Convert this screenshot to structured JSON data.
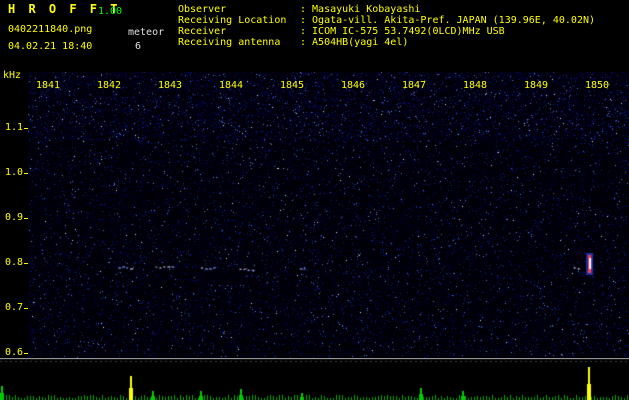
{
  "header": {
    "app_name": "H R O F F T",
    "version": "1.00",
    "filename": "0402211840.png",
    "mode": "meteor",
    "datetime": "04.02.21 18:40",
    "count": "6",
    "info": [
      {
        "label": "Observer",
        "value": ": Masayuki Kobayashi"
      },
      {
        "label": "Receiving Location",
        "value": ": Ogata-vill. Akita-Pref. JAPAN (139.96E, 40.02N)"
      },
      {
        "label": "Receiver",
        "value": ": ICOM IC-575 53.7492(0LCD)MHz USB"
      },
      {
        "label": "Receiving antenna",
        "value": ": A504HB(yagi 4el)"
      }
    ]
  },
  "spectrogram": {
    "unit_label": "kHz",
    "time_labels": [
      "1841",
      "1842",
      "1843",
      "1844",
      "1845",
      "1846",
      "1847",
      "1848",
      "1849",
      "1850"
    ],
    "freq_labels": [
      "1.1",
      "1.0",
      "0.9",
      "0.8",
      "0.7",
      "0.6"
    ],
    "freq_range_khz": [
      0.55,
      1.17
    ],
    "echoes": [
      {
        "t": 0.15,
        "f": 0.79,
        "w": 14
      },
      {
        "t": 0.212,
        "f": 0.79,
        "w": 18
      },
      {
        "t": 0.288,
        "f": 0.79,
        "w": 16
      },
      {
        "t": 0.352,
        "f": 0.785,
        "w": 13
      },
      {
        "t": 0.452,
        "f": 0.79,
        "w": 8
      },
      {
        "t": 0.908,
        "f": 0.79,
        "w": 6
      },
      {
        "t": 0.932,
        "f": 0.8,
        "w": 4,
        "bright": true
      }
    ],
    "colors": {
      "label": "#ffff00",
      "noise_bg": "#000006",
      "echo": "#8fb0ff",
      "echo_bright": "#ff4040"
    }
  },
  "signal_graph": {
    "spikes": [
      {
        "t": 0.003,
        "h": 14,
        "color": "#00cc00"
      },
      {
        "t": 0.207,
        "h": 24,
        "color": "#ffff00"
      },
      {
        "t": 0.242,
        "h": 9,
        "color": "#00cc00"
      },
      {
        "t": 0.318,
        "h": 9,
        "color": "#00cc00"
      },
      {
        "t": 0.383,
        "h": 11,
        "color": "#00cc00"
      },
      {
        "t": 0.48,
        "h": 7,
        "color": "#00cc00"
      },
      {
        "t": 0.668,
        "h": 12,
        "color": "#00cc00"
      },
      {
        "t": 0.736,
        "h": 9,
        "color": "#00cc00"
      },
      {
        "t": 0.935,
        "h": 33,
        "color": "#ffff00"
      }
    ],
    "baseline_color": "#00aa00",
    "separator_color": "#aaaaaa"
  }
}
